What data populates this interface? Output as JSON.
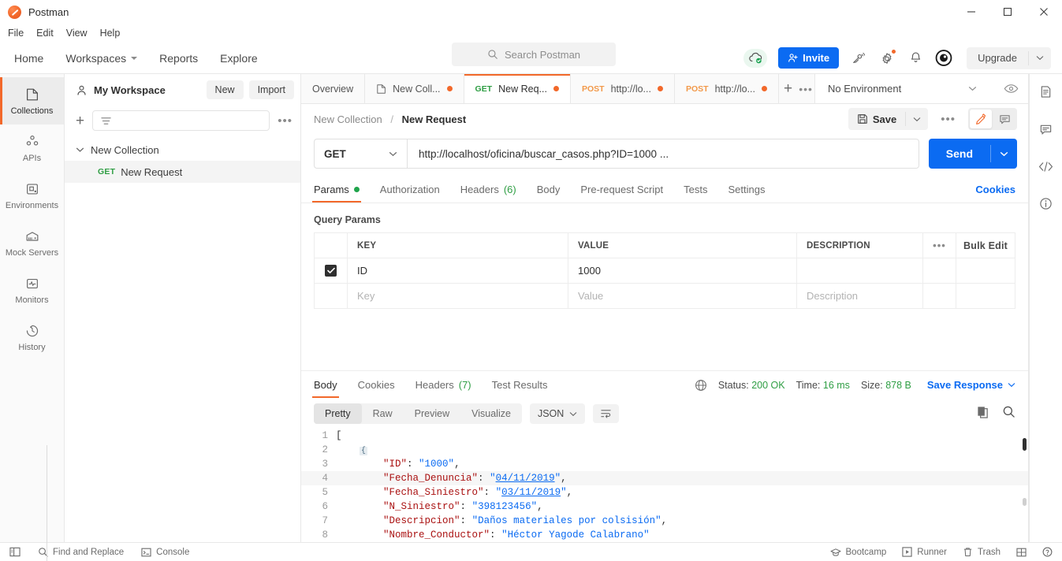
{
  "window": {
    "title": "Postman",
    "minimize": "minimize-icon",
    "maximize": "maximize-icon",
    "close": "close-icon"
  },
  "menubar": {
    "items": [
      "File",
      "Edit",
      "View",
      "Help"
    ]
  },
  "mainnav": {
    "items": [
      "Home",
      "Workspaces",
      "Reports",
      "Explore"
    ],
    "search_placeholder": "Search Postman",
    "invite_label": "Invite",
    "upgrade_label": "Upgrade"
  },
  "rail": {
    "items": [
      {
        "label": "Collections",
        "icon": "collection-icon",
        "active": true
      },
      {
        "label": "APIs",
        "icon": "apis-icon",
        "active": false
      },
      {
        "label": "Environments",
        "icon": "environments-icon",
        "active": false
      },
      {
        "label": "Mock Servers",
        "icon": "mock-servers-icon",
        "active": false
      },
      {
        "label": "Monitors",
        "icon": "monitors-icon",
        "active": false
      },
      {
        "label": "History",
        "icon": "history-icon",
        "active": false
      }
    ]
  },
  "workspace": {
    "name": "My Workspace",
    "new_label": "New",
    "import_label": "Import",
    "filter_placeholder": "",
    "tree": {
      "collection": "New Collection",
      "request_method": "GET",
      "request_name": "New Request"
    }
  },
  "tabs": {
    "overview": "Overview",
    "items": [
      {
        "method": "",
        "label": "New Coll...",
        "icon": "collection-icon",
        "unsaved": true,
        "active": false
      },
      {
        "method": "GET",
        "label": "New Req...",
        "unsaved": true,
        "active": true
      },
      {
        "method": "POST",
        "label": "http://lo...",
        "unsaved": true,
        "active": false
      },
      {
        "method": "POST",
        "label": "http://lo...",
        "unsaved": true,
        "active": false
      }
    ],
    "add_label": "+",
    "environment": "No Environment"
  },
  "request": {
    "breadcrumb": {
      "collection": "New Collection",
      "separator": "/",
      "name": "New Request"
    },
    "save_label": "Save",
    "method": "GET",
    "url": "http://localhost/oficina/buscar_casos.php?ID=1000 ...",
    "send_label": "Send",
    "tabs": [
      {
        "label": "Params",
        "badge": "dot",
        "active": true
      },
      {
        "label": "Authorization",
        "badge": "",
        "active": false
      },
      {
        "label": "Headers",
        "badge": "(6)",
        "active": false
      },
      {
        "label": "Body",
        "badge": "",
        "active": false
      },
      {
        "label": "Pre-request Script",
        "badge": "",
        "active": false
      },
      {
        "label": "Tests",
        "badge": "",
        "active": false
      },
      {
        "label": "Settings",
        "badge": "",
        "active": false
      }
    ],
    "cookies_link": "Cookies",
    "query_params_title": "Query Params",
    "params_table": {
      "headers": [
        "KEY",
        "VALUE",
        "DESCRIPTION"
      ],
      "bulk_edit": "Bulk Edit",
      "rows": [
        {
          "checked": true,
          "key": "ID",
          "value": "1000",
          "description": ""
        }
      ],
      "placeholder_row": {
        "key": "Key",
        "value": "Value",
        "description": "Description"
      }
    }
  },
  "response": {
    "tabs": [
      {
        "label": "Body",
        "badge": "",
        "active": true
      },
      {
        "label": "Cookies",
        "badge": "",
        "active": false
      },
      {
        "label": "Headers",
        "badge": "(7)",
        "active": false
      },
      {
        "label": "Test Results",
        "badge": "",
        "active": false
      }
    ],
    "status_label": "Status:",
    "status_value": "200 OK",
    "time_label": "Time:",
    "time_value": "16 ms",
    "size_label": "Size:",
    "size_value": "878 B",
    "save_response": "Save Response",
    "view_modes": [
      "Pretty",
      "Raw",
      "Preview",
      "Visualize"
    ],
    "active_view": "Pretty",
    "format": "JSON",
    "lines": [
      {
        "n": "1",
        "segments": [
          {
            "t": "[",
            "c": "p"
          }
        ]
      },
      {
        "n": "2",
        "segments": [
          {
            "t": "    {",
            "c": "fold"
          }
        ]
      },
      {
        "n": "3",
        "segments": [
          {
            "t": "        ",
            "c": "p"
          },
          {
            "t": "\"ID\"",
            "c": "k"
          },
          {
            "t": ": ",
            "c": "p"
          },
          {
            "t": "\"1000\"",
            "c": "s"
          },
          {
            "t": ",",
            "c": "p"
          }
        ]
      },
      {
        "n": "4",
        "highlight": true,
        "segments": [
          {
            "t": "        ",
            "c": "p"
          },
          {
            "t": "\"Fecha_Denuncia\"",
            "c": "k"
          },
          {
            "t": ": ",
            "c": "p"
          },
          {
            "t": "\"04/11/2019\"",
            "c": "s"
          },
          {
            "t": ",",
            "c": "p"
          }
        ]
      },
      {
        "n": "5",
        "segments": [
          {
            "t": "        ",
            "c": "p"
          },
          {
            "t": "\"Fecha_Siniestro\"",
            "c": "k"
          },
          {
            "t": ": ",
            "c": "p"
          },
          {
            "t": "\"03/11/2019\"",
            "c": "s"
          },
          {
            "t": ",",
            "c": "p"
          }
        ]
      },
      {
        "n": "6",
        "segments": [
          {
            "t": "        ",
            "c": "p"
          },
          {
            "t": "\"N_Siniestro\"",
            "c": "k"
          },
          {
            "t": ": ",
            "c": "p"
          },
          {
            "t": "\"398123456\"",
            "c": "s"
          },
          {
            "t": ",",
            "c": "p"
          }
        ]
      },
      {
        "n": "7",
        "segments": [
          {
            "t": "        ",
            "c": "p"
          },
          {
            "t": "\"Descripcion\"",
            "c": "k"
          },
          {
            "t": ": ",
            "c": "p"
          },
          {
            "t": "\"Daños materiales por colsisión\"",
            "c": "s"
          },
          {
            "t": ",",
            "c": "p"
          }
        ]
      },
      {
        "n": "8",
        "segments": [
          {
            "t": "        ",
            "c": "p"
          },
          {
            "t": "\"Nombre_Conductor\"",
            "c": "k"
          },
          {
            "t": ": ",
            "c": "p"
          },
          {
            "t": "\"Héctor Yagode Calabrano\"",
            "c": "s"
          }
        ]
      }
    ]
  },
  "rightrail": {
    "items": [
      "documentation-icon",
      "comment-icon",
      "code-icon",
      "info-icon"
    ]
  },
  "statusbar": {
    "left": [
      {
        "label": "",
        "icon": "sidebar-toggle-icon"
      },
      {
        "label": "Find and Replace",
        "icon": "search-icon"
      },
      {
        "label": "Console",
        "icon": "console-icon"
      }
    ],
    "right": [
      {
        "label": "Bootcamp",
        "icon": "bootcamp-icon"
      },
      {
        "label": "Runner",
        "icon": "runner-icon"
      },
      {
        "label": "Trash",
        "icon": "trash-icon"
      },
      {
        "label": "",
        "icon": "layout-icon"
      },
      {
        "label": "",
        "icon": "help-icon"
      }
    ]
  },
  "colors": {
    "accent": "#f2682a",
    "primary": "#0b6bf2",
    "success": "#2f9e44"
  }
}
